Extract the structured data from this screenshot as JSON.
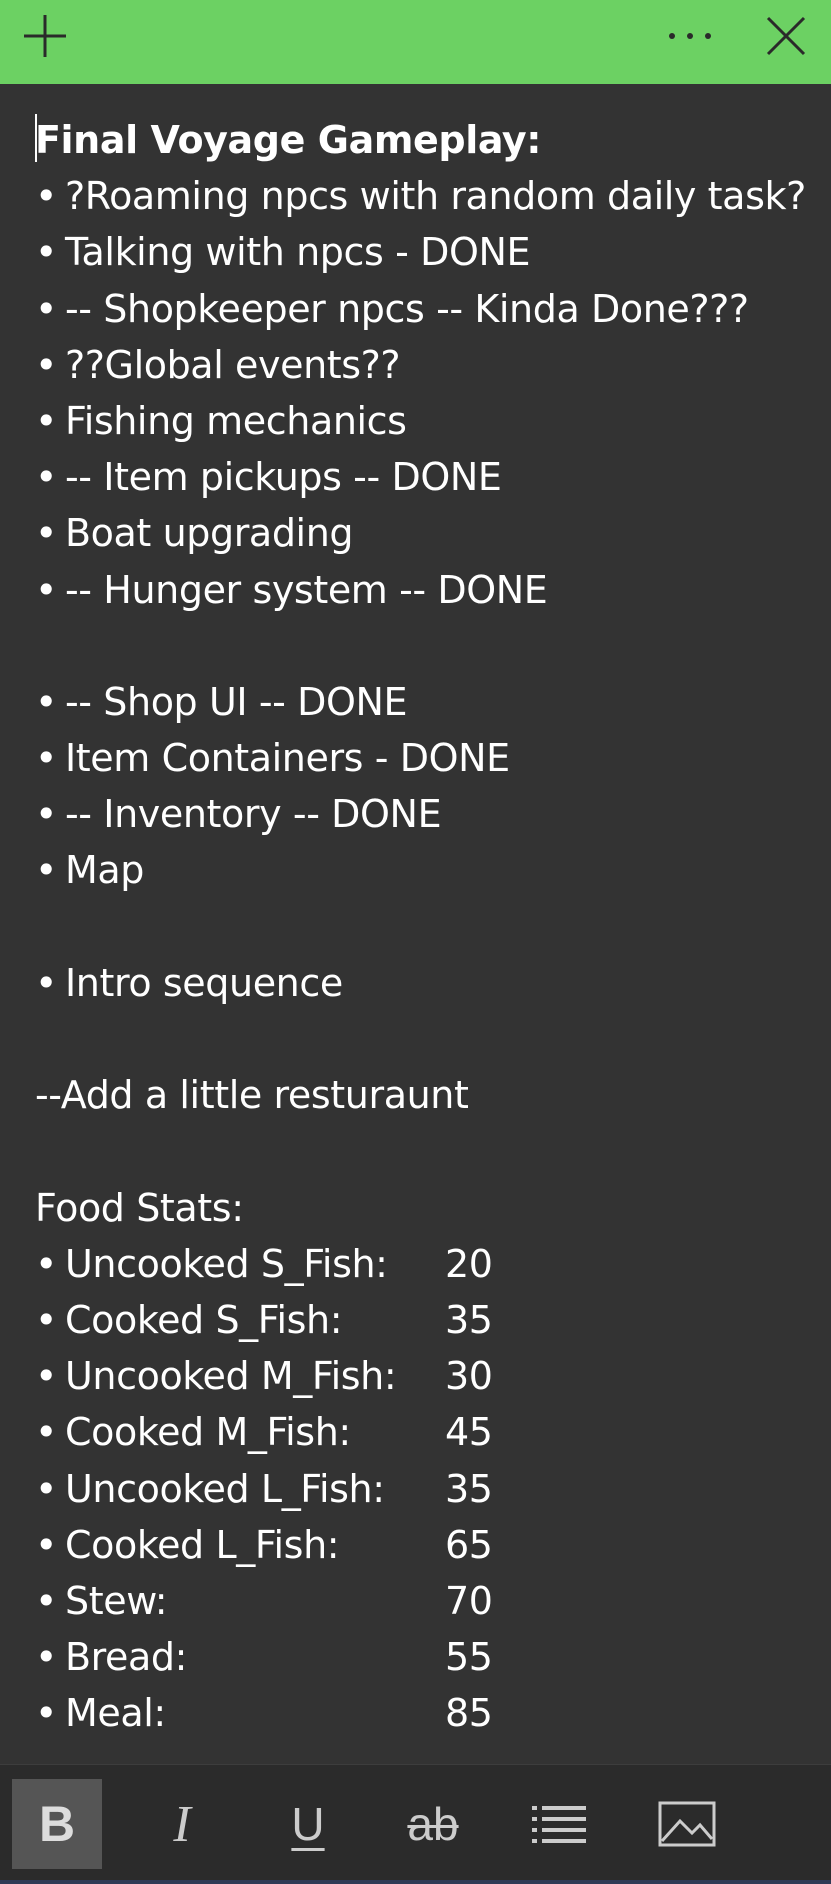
{
  "app": {
    "name": "Sticky Notes",
    "accent_color": "#6cd163",
    "background_color": "#333333"
  },
  "titlebar": {
    "add_icon": "plus-icon",
    "more_icon": "ellipsis-icon",
    "close_icon": "close-icon"
  },
  "note": {
    "title": "Final Voyage Gameplay:",
    "bullet": "•",
    "items": [
      "?Roaming npcs with random daily task?",
      "Talking with npcs - DONE",
      "-- Shopkeeper npcs -- Kinda Done???",
      "??Global events??",
      "Fishing mechanics",
      "-- Item pickups -- DONE",
      "Boat upgrading",
      "-- Hunger system -- DONE"
    ],
    "items2": [
      "-- Shop UI -- DONE",
      "Item Containers - DONE",
      "-- Inventory -- DONE",
      "Map"
    ],
    "items3": [
      "Intro sequence"
    ],
    "extra_line": "--Add a little resturaunt",
    "stats_heading": "Food Stats:",
    "stats": [
      {
        "name": "Uncooked S_Fish:",
        "value": "20"
      },
      {
        "name": "Cooked S_Fish:",
        "value": "35"
      },
      {
        "name": "Uncooked M_Fish:",
        "value": "30"
      },
      {
        "name": "Cooked M_Fish:",
        "value": "45"
      },
      {
        "name": "Uncooked L_Fish:",
        "value": "35"
      },
      {
        "name": "Cooked L_Fish:",
        "value": "65"
      },
      {
        "name": "Stew:",
        "value": "70"
      },
      {
        "name": "Bread:",
        "value": "55"
      },
      {
        "name": "Meal:",
        "value": "85"
      }
    ]
  },
  "toolbar": {
    "bold_label": "B",
    "italic_label": "I",
    "underline_label": "U",
    "strike_label": "ab",
    "list_icon": "bulleted-list-icon",
    "image_icon": "image-icon",
    "bold_active": true
  }
}
